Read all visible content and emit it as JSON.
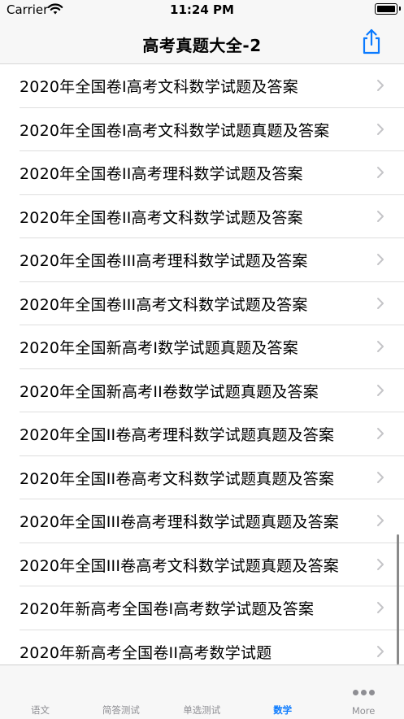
{
  "status_bar": {
    "carrier": "Carrier",
    "time": "11:24 PM"
  },
  "nav": {
    "title": "高考真题大全-2",
    "share_icon": "share-icon"
  },
  "list": {
    "items": [
      {
        "label": "2020年全国卷I高考文科数学试题及答案"
      },
      {
        "label": "2020年全国卷I高考文科数学试题真题及答案"
      },
      {
        "label": "2020年全国卷II高考理科数学试题及答案"
      },
      {
        "label": "2020年全国卷II高考文科数学试题及答案"
      },
      {
        "label": "2020年全国卷III高考理科数学试题及答案"
      },
      {
        "label": "2020年全国卷III高考文科数学试题及答案"
      },
      {
        "label": "2020年全国新高考I数学试题真题及答案"
      },
      {
        "label": "2020年全国新高考II卷数学试题真题及答案"
      },
      {
        "label": "2020年全国II卷高考理科数学试题真题及答案"
      },
      {
        "label": "2020年全国II卷高考文科数学试题真题及答案"
      },
      {
        "label": "2020年全国III卷高考理科数学试题真题及答案"
      },
      {
        "label": "2020年全国III卷高考文科数学试题真题及答案"
      },
      {
        "label": "2020年新高考全国卷I高考数学试题及答案"
      },
      {
        "label": "2020年新高考全国卷II高考数学试题"
      }
    ]
  },
  "tabs": [
    {
      "label": "语文",
      "active": false
    },
    {
      "label": "简答测试",
      "active": false
    },
    {
      "label": "单选测试",
      "active": false
    },
    {
      "label": "数学",
      "active": true
    },
    {
      "label": "More",
      "active": false
    }
  ],
  "colors": {
    "accent": "#0a7aff",
    "inactive_tab": "#8e8e93",
    "bar_background": "#f7f7f7",
    "separator": "#dedede"
  }
}
